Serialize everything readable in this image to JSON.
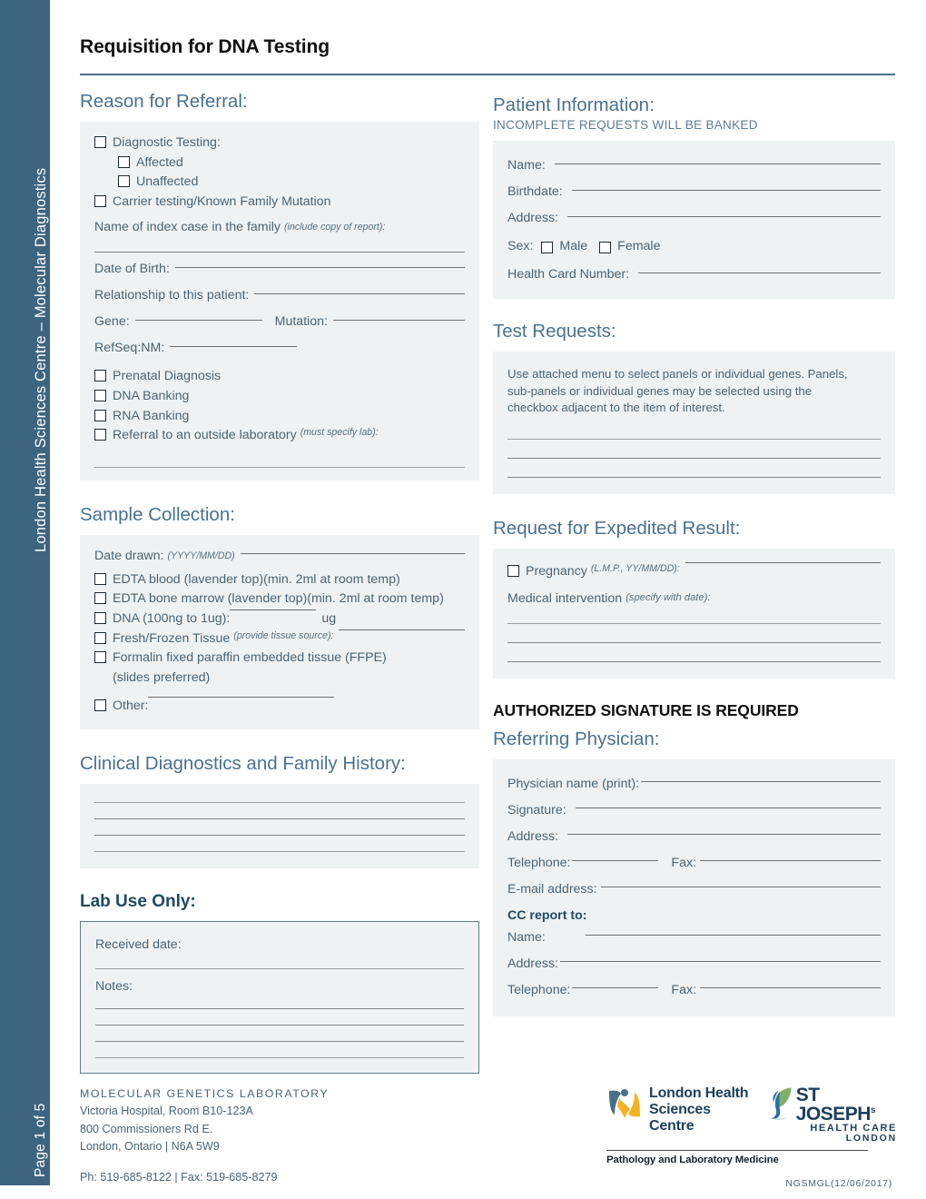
{
  "sidebar": {
    "title": "London Health Sciences Centre – Molecular Diagnostics",
    "page_label": "Page 1 of 5"
  },
  "document": {
    "title": "Requisition for DNA Testing"
  },
  "reason_for_referral": {
    "heading": "Reason for Referral:",
    "checkboxes": [
      {
        "label": "Diagnostic Testing:"
      },
      {
        "label": "Affected"
      },
      {
        "label": "Unaffected"
      },
      {
        "label": "Carrier testing/Known Family Mutation"
      }
    ],
    "index_case_label": "Name of index case in the family",
    "index_case_note": "(include copy of report):",
    "date_of_birth_label": "Date of Birth:",
    "relationship_label": "Relationship to this patient:",
    "gene_label": "Gene:",
    "mutation_label": "Mutation:",
    "refseq_label": "RefSeq:NM:",
    "options": [
      {
        "label": "Prenatal Diagnosis"
      },
      {
        "label": "DNA Banking"
      },
      {
        "label": "RNA Banking"
      },
      {
        "label": "Referral to an outside laboratory"
      }
    ],
    "referral_note": "(must specify lab):"
  },
  "patient_information": {
    "heading": "Patient Information:",
    "subheading": "INCOMPLETE REQUESTS WILL BE BANKED",
    "name_label": "Name:",
    "birthdate_label": "Birthdate:",
    "address_label": "Address:",
    "sex_label": "Sex:",
    "sex_male": "Male",
    "sex_female": "Female",
    "health_card_label": "Health Card Number:"
  },
  "test_requests": {
    "heading": "Test Requests:",
    "instructions": "Use attached menu to select panels or individual genes. Panels, sub-panels or individual genes may be selected using the checkbox adjacent to the item of interest."
  },
  "sample_collection": {
    "heading": "Sample Collection:",
    "date_drawn_label": "Date drawn:",
    "date_drawn_format": "(YYYY/MM/DD)",
    "options": [
      {
        "label": "EDTA blood (lavender top)(min. 2ml at room temp)"
      },
      {
        "label": "EDTA bone marrow (lavender top)(min. 2ml at room temp)"
      },
      {
        "label": "DNA (100ng to 1ug):"
      },
      {
        "label": "Fresh/Frozen Tissue"
      },
      {
        "label": "Formalin fixed paraffin embedded tissue (FFPE)"
      },
      {
        "label": "Other:"
      }
    ],
    "dna_unit": "ug",
    "tissue_note": "(provide tissue source):",
    "ffpe_second_line": "(slides preferred)"
  },
  "expedited_result": {
    "heading": "Request for Expedited Result:",
    "pregnancy_label": "Pregnancy",
    "pregnancy_note": "(L.M.P., YY/MM/DD):",
    "medical_intervention_label": "Medical intervention",
    "medical_intervention_note": "(specify with date):"
  },
  "clinical_diagnostics": {
    "heading": "Clinical Diagnostics and Family History:"
  },
  "lab_use_only": {
    "heading": "Lab Use Only:",
    "received_date_label": "Received date:",
    "notes_label": "Notes:"
  },
  "referring_physician": {
    "notice": "AUTHORIZED SIGNATURE IS REQUIRED",
    "heading": "Referring Physician:",
    "physician_name_label": "Physician name (print):",
    "signature_label": "Signature:",
    "address_label": "Address:",
    "telephone_label": "Telephone:",
    "fax_label": "Fax:",
    "email_label": "E-mail address:",
    "cc_heading": "CC report to:",
    "cc_name_label": "Name:",
    "cc_address_label": "Address:",
    "cc_telephone_label": "Telephone:",
    "cc_fax_label": "Fax:"
  },
  "footer": {
    "lab_name": "MOLECULAR GENETICS LABORATORY",
    "address_line1": "Victoria Hospital, Room B10-123A",
    "address_line2": "800 Commissioners Rd E.",
    "address_line3": "London, Ontario  |  N6A 5W9",
    "phone_fax": "Ph: 519-685-8122  |  Fax: 519-685-8279",
    "lhsc_line1": "London Health",
    "lhsc_line2": "Sciences Centre",
    "stjoseph_line1": "ST JOSEPH",
    "stjoseph_sup": "s",
    "stjoseph_line2": "HEALTH CARE",
    "stjoseph_line3": "LONDON",
    "pathology_line": "Pathology and Laboratory Medicine",
    "doc_id": "NGSMGL(12/06/2017)"
  },
  "colors": {
    "sidebar": "#3e6580",
    "heading": "#4a7190",
    "panel_bg": "#eef2f3",
    "body_text": "#4a6475",
    "logo_blue": "#1c3f5e",
    "logo_yellow": "#f5b323",
    "logo_slate": "#4a6f8a",
    "stjoseph_green": "#7fb069"
  }
}
